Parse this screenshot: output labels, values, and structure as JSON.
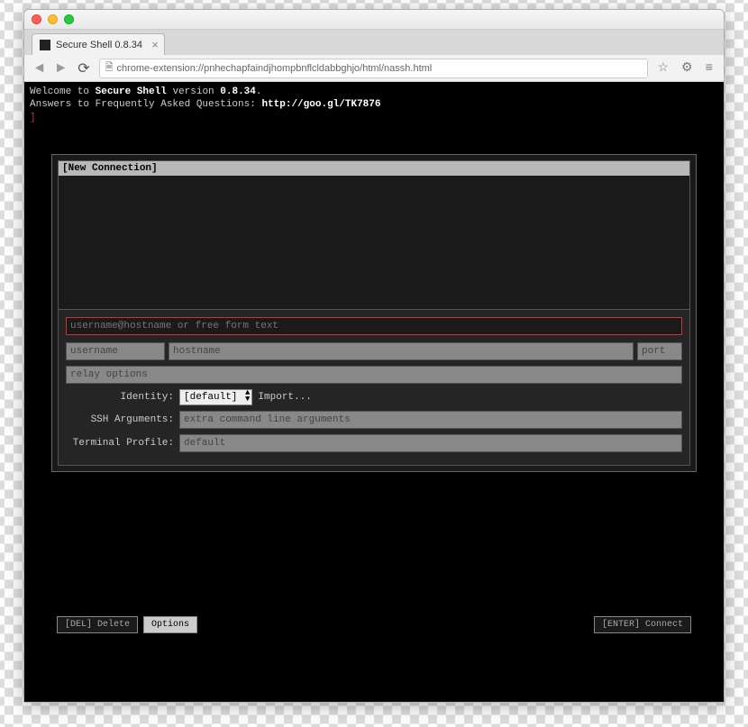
{
  "window": {
    "tab_title": "Secure Shell 0.8.34",
    "url": "chrome-extension://pnhechapfaindjhompbnflcldabbghjo/html/nassh.html"
  },
  "terminal": {
    "line1_pre": "Welcome to ",
    "line1_bold": "Secure Shell",
    "line1_mid": " version ",
    "line1_ver": "0.8.34",
    "line1_end": ".",
    "line2_pre": "Answers to Frequently Asked Questions: ",
    "line2_url": "http://goo.gl/TK7876",
    "cursor": "]"
  },
  "dialog": {
    "header": "[New Connection]",
    "destination_placeholder": "username@hostname or free form text",
    "username_placeholder": "username",
    "hostname_placeholder": "hostname",
    "port_placeholder": "port",
    "relay_placeholder": "relay options",
    "identity_label": "Identity:",
    "identity_value": "[default]",
    "import_label": "Import...",
    "ssh_args_label": "SSH Arguments:",
    "ssh_args_placeholder": "extra command line arguments",
    "profile_label": "Terminal Profile:",
    "profile_placeholder": "default"
  },
  "footer": {
    "delete": "[DEL] Delete",
    "options": "Options",
    "connect": "[ENTER] Connect"
  }
}
